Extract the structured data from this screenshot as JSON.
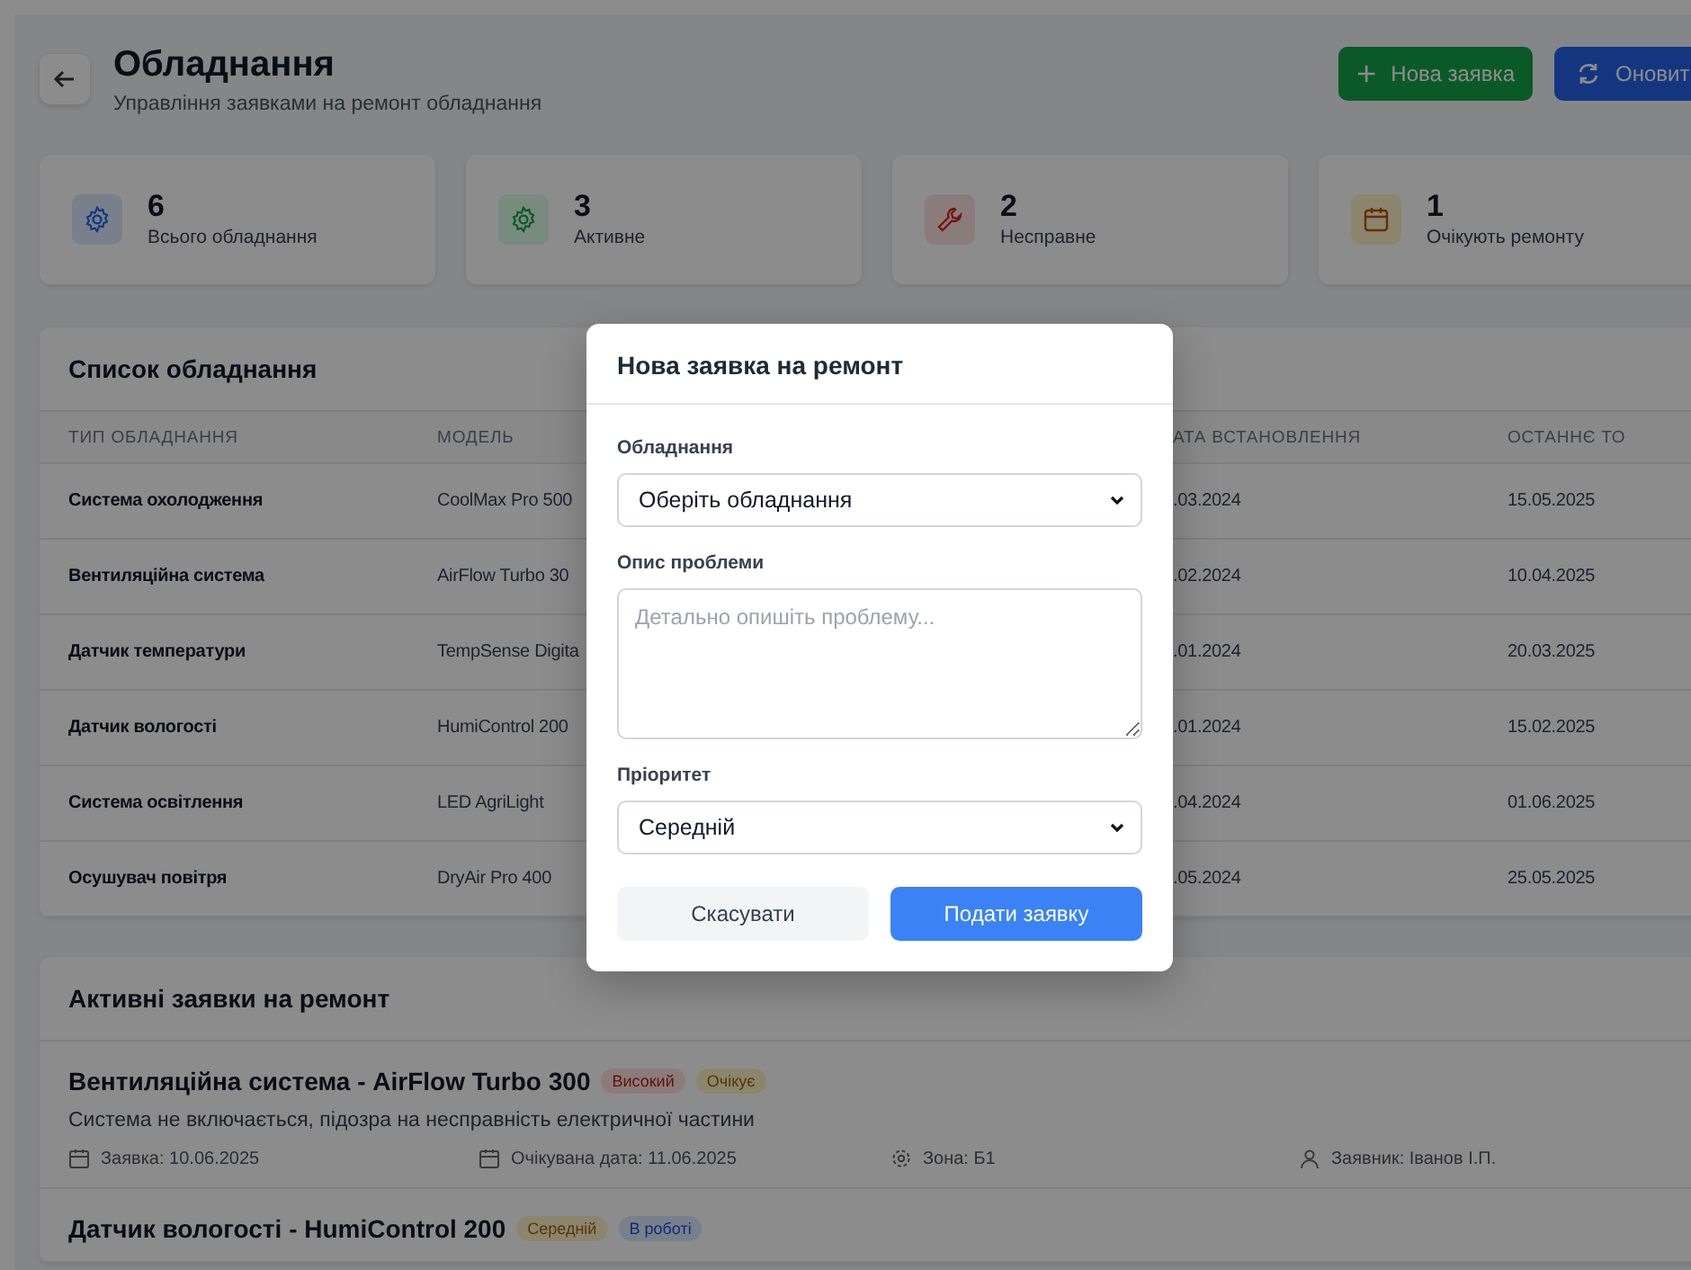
{
  "header": {
    "title": "Обладнання",
    "subtitle": "Управління заявками на ремонт обладнання",
    "buttons": [
      {
        "label": "Нова заявка",
        "kind": "add"
      },
      {
        "label": "Оновит",
        "kind": "refresh"
      }
    ]
  },
  "stats": [
    {
      "value": "6",
      "label": "Всього обладнання",
      "kind": "total"
    },
    {
      "value": "3",
      "label": "Активне",
      "kind": "active"
    },
    {
      "value": "2",
      "label": "Несправне",
      "kind": "broken"
    },
    {
      "value": "1",
      "label": "Очікують ремонту",
      "kind": "pending"
    }
  ],
  "equipment_table": {
    "title": "Список обладнання",
    "columns": [
      "ТИП ОБЛАДНАННЯ",
      "МОДЕЛЬ",
      "АТА ВСТАНОВЛЕННЯ",
      "ОСТАННЄ ТО"
    ],
    "rows": [
      {
        "cells": [
          "Система охолодження",
          "CoolMax Pro 500",
          ".03.2024",
          "15.05.2025"
        ]
      },
      {
        "cells": [
          "Вентиляційна система",
          "AirFlow Turbo 30",
          ".02.2024",
          "10.04.2025"
        ]
      },
      {
        "cells": [
          "Датчик температури",
          "TempSense Digita",
          ".01.2024",
          "20.03.2025"
        ]
      },
      {
        "cells": [
          "Датчик вологості",
          "HumiControl 200",
          ".01.2024",
          "15.02.2025"
        ]
      },
      {
        "cells": [
          "Система освітлення",
          "LED AgriLight",
          ".04.2024",
          "01.06.2025"
        ]
      },
      {
        "cells": [
          "Осушувач повітря",
          "DryAir Pro 400",
          ".05.2024",
          "25.05.2025"
        ]
      }
    ]
  },
  "active_requests": {
    "title": "Активні заявки на ремонт",
    "items": [
      {
        "title": "Вентиляційна система - AirFlow Turbo 300",
        "badges": [
          {
            "label": "Високий",
            "kind": "high"
          },
          {
            "label": "Очікує",
            "kind": "waiting"
          }
        ],
        "description": "Система не включається, підозра на несправність електричної частини",
        "meta": [
          {
            "kind": "date",
            "text": "Заявка: 10.06.2025"
          },
          {
            "kind": "date",
            "text": "Очікувана дата: 11.06.2025"
          },
          {
            "kind": "zone",
            "text": "Зона: Б1"
          },
          {
            "kind": "user",
            "text": "Заявник: Іванов І.П."
          }
        ]
      },
      {
        "title": "Датчик вологості - HumiControl 200",
        "badges": [
          {
            "label": "Середній",
            "kind": "medium"
          },
          {
            "label": "В роботі",
            "kind": "progress"
          }
        ]
      }
    ]
  },
  "modal": {
    "title": "Нова заявка на ремонт",
    "fields": [
      {
        "label": "Обладнання",
        "kind": "select",
        "value": "Оберіть обладнання"
      },
      {
        "label": "Опис проблеми",
        "kind": "textarea",
        "placeholder": "Детально опишіть проблему..."
      },
      {
        "label": "Пріоритет",
        "kind": "select",
        "value": "Середній"
      }
    ],
    "buttons": [
      {
        "label": "Скасувати",
        "kind": "secondary"
      },
      {
        "label": "Подати заявку",
        "kind": "primary"
      }
    ]
  }
}
